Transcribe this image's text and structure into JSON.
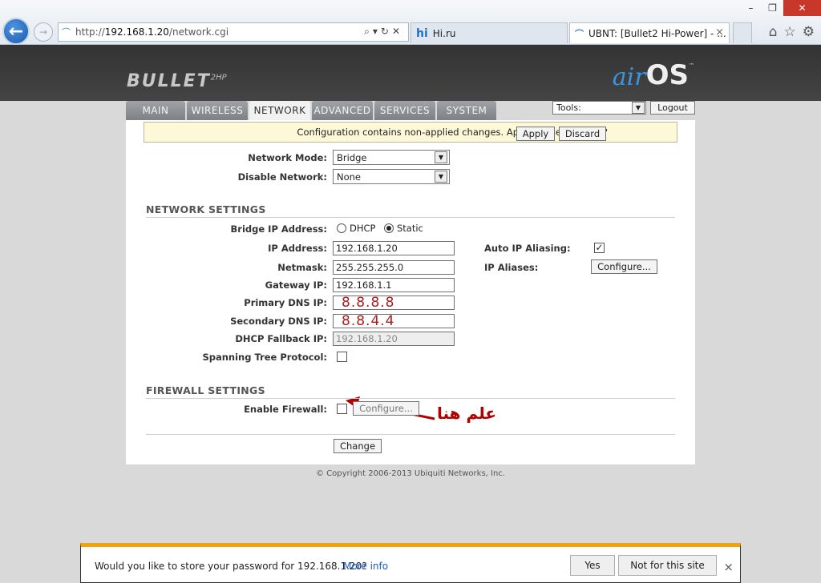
{
  "browser": {
    "url_prefix": "http://",
    "url_host": "192.168.1.20",
    "url_path": "/network.cgi",
    "tabs": [
      {
        "icon": "hi",
        "label": "Hi.ru"
      },
      {
        "icon": "ubnt",
        "label": "UBNT: [Bullet2 Hi-Power] - ..."
      }
    ],
    "close_glyph": "×"
  },
  "header": {
    "brand": "BULLET",
    "brand_model": "2HP",
    "logo_air": "air",
    "logo_os": "OS",
    "logo_tm": "™"
  },
  "nav": {
    "tabs": [
      "MAIN",
      "WIRELESS",
      "NETWORK",
      "ADVANCED",
      "SERVICES",
      "SYSTEM"
    ],
    "active": "NETWORK",
    "tools_value": "Tools:",
    "logout_label": "Logout"
  },
  "notice": {
    "text": "Configuration contains non-applied changes. Apply these changes?",
    "apply_label": "Apply",
    "discard_label": "Discard"
  },
  "network_mode": {
    "label": "Network Mode:",
    "value": "Bridge"
  },
  "disable_network": {
    "label": "Disable Network:",
    "value": "None"
  },
  "network_settings": {
    "heading": "NETWORK SETTINGS",
    "bridge_ip_label": "Bridge IP Address:",
    "dhcp_label": "DHCP",
    "static_label": "Static",
    "selected_mode": "Static",
    "ip_label": "IP Address:",
    "ip_value": "192.168.1.20",
    "netmask_label": "Netmask:",
    "netmask_value": "255.255.255.0",
    "gateway_label": "Gateway IP:",
    "gateway_value": "192.168.1.1",
    "primary_dns_label": "Primary DNS IP:",
    "primary_dns_value": "8.8.8.8",
    "secondary_dns_label": "Secondary DNS IP:",
    "secondary_dns_value": "8.8.4.4",
    "dhcp_fallback_label": "DHCP Fallback IP:",
    "dhcp_fallback_value": "192.168.1.20",
    "stp_label": "Spanning Tree Protocol:",
    "stp_checked": false,
    "auto_alias_label": "Auto IP Aliasing:",
    "auto_alias_checked": true,
    "ip_aliases_label": "IP Aliases:",
    "configure_label": "Configure..."
  },
  "annotation": {
    "arabic_text": "علم هنا",
    "color": "#b00000"
  },
  "firewall": {
    "heading": "FIREWALL SETTINGS",
    "enable_label": "Enable Firewall:",
    "enabled": false,
    "configure_label": "Configure..."
  },
  "change_label": "Change",
  "copyright": "© Copyright 2006-2013 Ubiquiti Networks, Inc.",
  "password_bar": {
    "message": "Would you like to store your password for 192.168.1.20?",
    "more_info": "More info",
    "yes_label": "Yes",
    "no_label": "Not for this site",
    "close_glyph": "×",
    "accent": "#f0a30a"
  }
}
